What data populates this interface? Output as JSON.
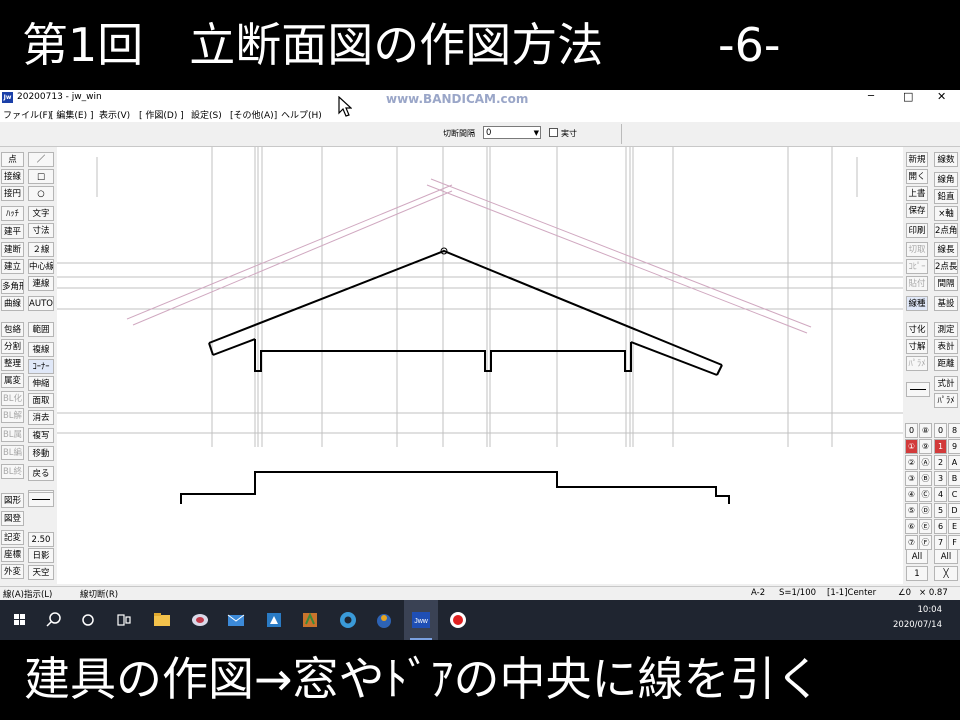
{
  "captions": {
    "top_title": "第1回　立断面図の作図方法",
    "top_part": "-6-",
    "bottom": "建具の作図→窓やﾄﾞｱの中央に線を引く"
  },
  "watermark": "www.BANDICAM.com",
  "window": {
    "title": "20200713 - jw_win",
    "app_icon": "jw-icon",
    "minimize": "─",
    "maximize": "□",
    "close": "✕"
  },
  "menu": [
    "ファイル(F)",
    "[ 編集(E) ]",
    "表示(V)",
    "[ 作図(D) ]",
    "設定(S)",
    "[その他(A)]",
    "ヘルプ(H)"
  ],
  "toolbar_top": {
    "label": "切断間隔",
    "value": "0",
    "dropdown_arrow": "▼",
    "checkbox_label": "実寸",
    "checkbox_checked": false
  },
  "left_col1": [
    "点",
    "接線",
    "接円",
    "ﾊｯﾁ",
    "建平",
    "建断",
    "建立",
    "多角形",
    "曲線",
    "包絡",
    "分割",
    "整理",
    "属変",
    "BL化",
    "BL解",
    "BL属",
    "BL編",
    "BL終",
    "図形",
    "図登",
    "記変",
    "座標",
    "外変"
  ],
  "left_col2": [
    "／",
    "□",
    "○",
    "文字",
    "寸法",
    "２線",
    "中心線",
    "連線",
    "AUTO",
    "範囲",
    "複線",
    "ｺｰﾅｰ",
    "伸縮",
    "面取",
    "消去",
    "複写",
    "移動",
    "戻る",
    "",
    "2.50",
    "日影",
    "天空"
  ],
  "right_col1": [
    "新規",
    "開く",
    "上書",
    "保存",
    "印刷",
    "切取",
    "ｺﾋﾟｰ",
    "貼付",
    "線種",
    "寸化",
    "寸解",
    "ﾊﾟﾗﾒ",
    "",
    "",
    "",
    ""
  ],
  "right_col2": [
    "線数",
    "線角",
    "鉛直",
    "×軸",
    "2点角",
    "線長",
    "2点長",
    "間隔",
    "基設",
    "測定",
    "表計",
    "距離",
    "式計",
    "ﾊﾟﾗﾒ"
  ],
  "layer_grid": {
    "col1": [
      "0",
      "①",
      "②",
      "③",
      "④",
      "⑤",
      "⑥",
      "⑦"
    ],
    "col2": [
      "⑧",
      "⑨",
      "Ⓐ",
      "Ⓑ",
      "Ⓒ",
      "Ⓓ",
      "Ⓔ",
      "Ⓕ"
    ],
    "col3": [
      "0",
      "1",
      "2",
      "3",
      "4",
      "5",
      "6",
      "7"
    ],
    "col4": [
      "8",
      "9",
      "A",
      "B",
      "C",
      "D",
      "E",
      "F"
    ],
    "all1": "All",
    "all2": "All",
    "current": "1",
    "x_btn": "╳"
  },
  "status": {
    "left": "線(A)指示(L)",
    "mid": "線切断(R)",
    "paper": "A-2",
    "scale": "S=1/100",
    "layer": "[1-1]Center",
    "angle": "∠0",
    "zoom": "× 0.87"
  },
  "taskbar": {
    "icons": [
      "windows-start-icon",
      "search-icon",
      "cortana-icon",
      "task-view-icon",
      "file-explorer-icon",
      "app-icon",
      "mail-icon",
      "store-icon",
      "app2-icon",
      "edge-icon",
      "app3-icon",
      "jw-cad-icon",
      "bandicam-record-icon"
    ],
    "time": "10:04",
    "date": "2020/07/14"
  },
  "colors": {
    "drawing_line": "#000000",
    "aux_line": "#b4b4b4",
    "aux_line_pink": "#d0a8c0",
    "active_layer": "#d23a3a"
  }
}
